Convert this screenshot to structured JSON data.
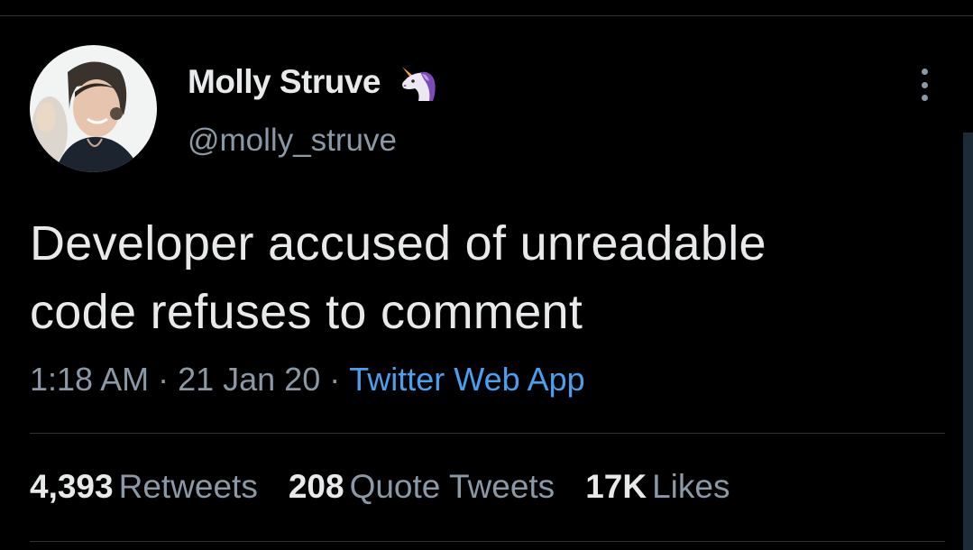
{
  "author": {
    "display_name": "Molly Struve",
    "handle": "@molly_struve",
    "name_emoji": "unicorn-icon"
  },
  "tweet": {
    "text_lines": [
      "Developer accused of unreadable",
      "code refuses to comment"
    ],
    "time": "1:18 AM",
    "date": "21 Jan 20",
    "separator": "·",
    "source": "Twitter Web App"
  },
  "stats": [
    {
      "count": "4,393",
      "label": "Retweets"
    },
    {
      "count": "208",
      "label": "Quote Tweets"
    },
    {
      "count": "17K",
      "label": "Likes"
    }
  ],
  "colors": {
    "background": "#000000",
    "primary_text": "#e7e9ea",
    "secondary_text": "#8b98a5",
    "link": "#4a9ff0",
    "divider": "#2f3336"
  },
  "icons": {
    "more": "more-vertical-icon",
    "avatar": "avatar"
  }
}
